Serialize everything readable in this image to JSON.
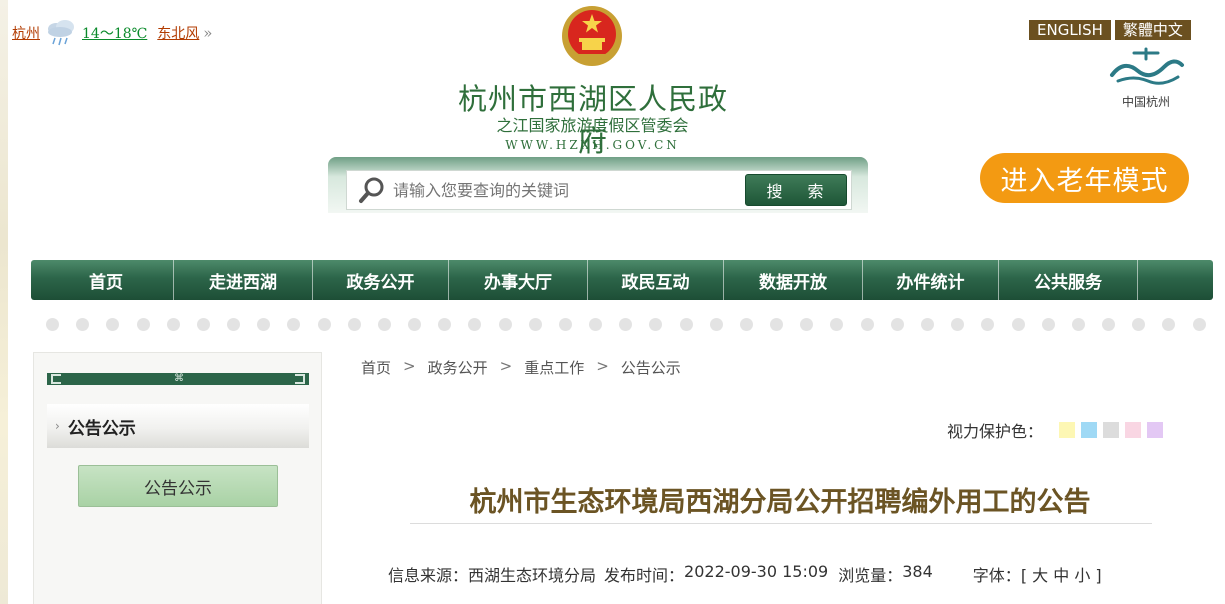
{
  "weather": {
    "city": "杭州",
    "temp": "14～18℃",
    "wind": "东北风",
    "more": "»"
  },
  "header": {
    "title": "杭州市西湖区人民政府",
    "subtitle": "之江国家旅游度假区管委会",
    "url": "WWW.HZXH.GOV.CN"
  },
  "lang": {
    "english": "ENGLISH",
    "traditional": "繁體中文"
  },
  "hz_logo": {
    "text": "中国杭州"
  },
  "search": {
    "placeholder": "请输入您要查询的关键词",
    "button": "搜 索"
  },
  "elder_mode": "进入老年模式",
  "nav": [
    "首页",
    "走进西湖",
    "政务公开",
    "办事大厅",
    "政民互动",
    "数据开放",
    "办件统计",
    "公共服务"
  ],
  "sidebar": {
    "heading": "公告公示",
    "item": "公告公示"
  },
  "breadcrumb": [
    "首页",
    "政务公开",
    "重点工作",
    "公告公示"
  ],
  "breadcrumb_sep": ">",
  "eye_protect": {
    "label": "视力保护色：",
    "colors": [
      "#fdf7b4",
      "#9fd9f5",
      "#dcdcdc",
      "#f9d6e3",
      "#e3c8f4"
    ]
  },
  "article": {
    "title": "杭州市生态环境局西湖分局公开招聘编外用工的公告",
    "source_label": "信息来源：",
    "source": "西湖生态环境分局",
    "time_label": "发布时间：",
    "time": "2022-09-30 15:09",
    "views_label": "浏览量：",
    "views": "384",
    "font_label": "字体：",
    "font_opts": "[ 大 中 小 ]"
  },
  "colors": {
    "primary_green": "#2c6549",
    "title_brown": "#6b5424",
    "elder_orange": "#f39a12"
  }
}
